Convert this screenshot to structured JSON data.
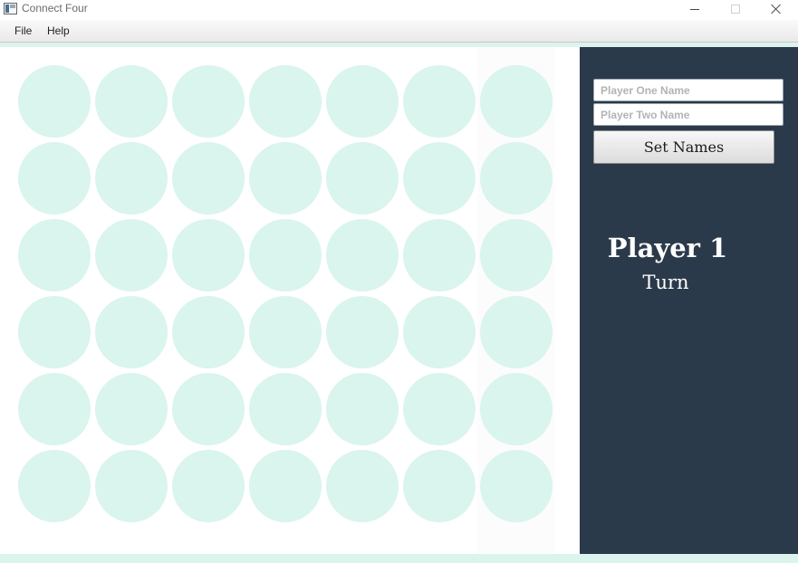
{
  "window": {
    "title": "Connect Four",
    "controls": [
      "minimize",
      "maximize",
      "close"
    ]
  },
  "menu": {
    "items": [
      {
        "label": "File"
      },
      {
        "label": "Help"
      }
    ]
  },
  "board": {
    "columns": 7,
    "rows": 6,
    "hovered_column": 7,
    "cells": [
      [
        "empty",
        "empty",
        "empty",
        "empty",
        "empty",
        "empty",
        "empty"
      ],
      [
        "empty",
        "empty",
        "empty",
        "empty",
        "empty",
        "empty",
        "empty"
      ],
      [
        "empty",
        "empty",
        "empty",
        "empty",
        "empty",
        "empty",
        "empty"
      ],
      [
        "empty",
        "empty",
        "empty",
        "empty",
        "empty",
        "empty",
        "empty"
      ],
      [
        "empty",
        "empty",
        "empty",
        "empty",
        "empty",
        "empty",
        "empty"
      ],
      [
        "empty",
        "empty",
        "empty",
        "empty",
        "empty",
        "empty",
        "empty"
      ]
    ]
  },
  "sidebar": {
    "player_one_placeholder": "Player One Name",
    "player_two_placeholder": "Player Two Name",
    "player_one_value": "",
    "player_two_value": "",
    "set_names_label": "Set Names",
    "current_player": "Player 1",
    "turn_label": "Turn"
  },
  "colors": {
    "empty_cell": "#daf4ee",
    "sidebar_background": "#2b3a4a",
    "accent_strip": "#dbf4ee"
  }
}
